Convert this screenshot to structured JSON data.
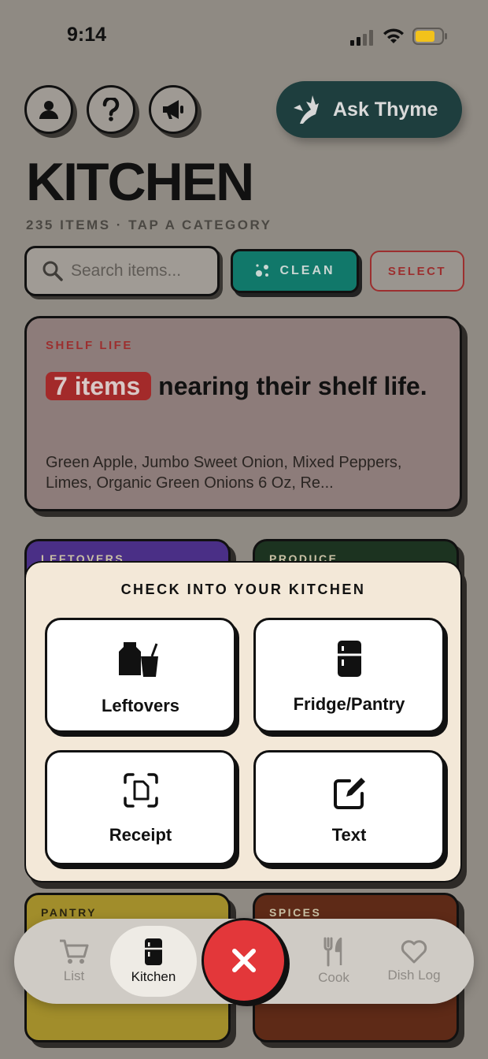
{
  "status": {
    "time": "9:14"
  },
  "header": {
    "ask_label": "Ask Thyme",
    "title": "KITCHEN",
    "subtitle": "235 ITEMS · TAP A CATEGORY"
  },
  "toolbar": {
    "search_placeholder": "Search items...",
    "clean_label": "CLEAN",
    "select_label": "SELECT"
  },
  "shelf_card": {
    "label": "SHELF LIFE",
    "badge": "7 items",
    "headline_rest": "nearing their shelf life.",
    "items_text": "Green Apple, Jumbo Sweet Onion, Mixed Peppers, Limes, Organic Green Onions 6 Oz, Re..."
  },
  "categories": [
    {
      "label": "LEFTOVERS",
      "color": "#4a2f86"
    },
    {
      "label": "PRODUCE",
      "color": "#1c3320"
    },
    {
      "label": "PANTRY",
      "color": "#a18d2b"
    },
    {
      "label": "SPICES",
      "color": "#5e2a17"
    }
  ],
  "sheet": {
    "title": "CHECK INTO YOUR KITCHEN",
    "options": [
      {
        "label": "Leftovers",
        "icon": "leftovers-icon"
      },
      {
        "label": "Fridge/Pantry",
        "icon": "fridge-icon"
      },
      {
        "label": "Receipt",
        "icon": "receipt-scan-icon"
      },
      {
        "label": "Text",
        "icon": "edit-icon"
      }
    ]
  },
  "tabbar": {
    "tabs": [
      {
        "label": "List",
        "icon": "cart-icon"
      },
      {
        "label": "Kitchen",
        "icon": "fridge-icon"
      },
      {
        "label": "Cook",
        "icon": "fork-knife-icon"
      },
      {
        "label": "Dish Log",
        "icon": "heart-icon"
      }
    ],
    "active": "Kitchen"
  },
  "colors": {
    "accent_red": "#e3373a",
    "teal": "#11786a",
    "ask_bg": "#1e3e3e",
    "sheet_bg": "#f3e8d8"
  }
}
